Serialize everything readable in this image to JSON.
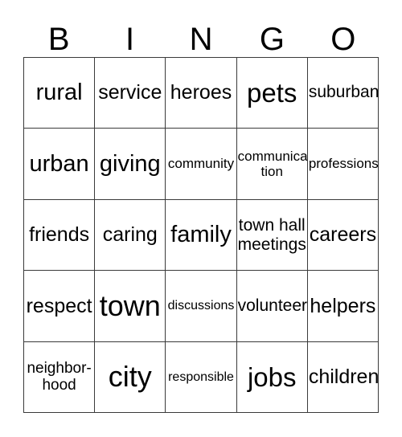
{
  "card": {
    "title": "BINGO",
    "header_letters": [
      "B",
      "I",
      "N",
      "G",
      "O"
    ],
    "border_color": "#3a3a3a",
    "text_color": "#000000",
    "background_color": "#ffffff",
    "rows": 5,
    "columns": 5,
    "cells": [
      [
        {
          "text": "rural",
          "size": "fs-l"
        },
        {
          "text": "service",
          "size": "fs-m"
        },
        {
          "text": "heroes",
          "size": "fs-m"
        },
        {
          "text": "pets",
          "size": "fs-xl"
        },
        {
          "text": "suburban",
          "size": "fs-s"
        }
      ],
      [
        {
          "text": "urban",
          "size": "fs-l"
        },
        {
          "text": "giving",
          "size": "fs-l"
        },
        {
          "text": "community",
          "size": "fs-xxs"
        },
        {
          "text": "communica-\ntion",
          "size": "fs-xxs"
        },
        {
          "text": "professions",
          "size": "fs-xxs"
        }
      ],
      [
        {
          "text": "friends",
          "size": "fs-m"
        },
        {
          "text": "caring",
          "size": "fs-m"
        },
        {
          "text": "family",
          "size": "fs-l"
        },
        {
          "text": "town hall\nmeetings",
          "size": "fs-s"
        },
        {
          "text": "careers",
          "size": "fs-m"
        }
      ],
      [
        {
          "text": "respect",
          "size": "fs-m"
        },
        {
          "text": "town",
          "size": "fs-xxl"
        },
        {
          "text": "discussions",
          "size": "fs-tiny"
        },
        {
          "text": "volunteer",
          "size": "fs-s"
        },
        {
          "text": "helpers",
          "size": "fs-m"
        }
      ],
      [
        {
          "text": "neighbor-\nhood",
          "size": "fs-xs"
        },
        {
          "text": "city",
          "size": "fs-xxl"
        },
        {
          "text": "responsible",
          "size": "fs-tiny"
        },
        {
          "text": "jobs",
          "size": "fs-xl"
        },
        {
          "text": "children",
          "size": "fs-m"
        }
      ]
    ]
  }
}
